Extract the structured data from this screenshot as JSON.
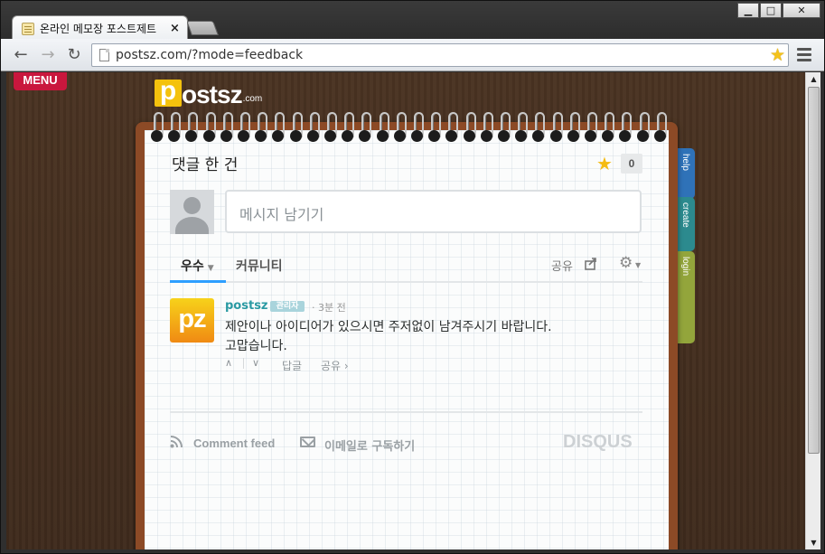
{
  "browser": {
    "tab_title": "온라인 메모장 포스트제트",
    "tab_close": "×",
    "url": "postsz.com/?mode=feedback",
    "window_controls": {
      "minimize": "▁",
      "maximize": "□",
      "close": "✕"
    },
    "icons": {
      "back": "arrow-left",
      "forward": "arrow-right",
      "reload": "reload",
      "bookmark": "star",
      "menu": "hamburger"
    }
  },
  "site": {
    "menu_label": "MENU",
    "logo": {
      "letter": "p",
      "rest": "ostsz",
      "suffix": ".com"
    },
    "side_tabs": [
      {
        "label": "help",
        "color": "#2f72b8"
      },
      {
        "label": "create",
        "color": "#2c8a8e"
      },
      {
        "label": "login",
        "color": "#93a53b"
      }
    ]
  },
  "disqus": {
    "title": "댓글 한 건",
    "star_count": "0",
    "input_placeholder": "메시지 남기기",
    "tabs": {
      "sort_label": "우수",
      "community_label": "커뮤니티"
    },
    "share_label": "공유",
    "post": {
      "avatar_text": "pz",
      "author": "postsz",
      "badge": "관리자",
      "time": "· 3분 전",
      "body_line1": "제안이나 아이디어가 있으시면 주저없이 남겨주시기 바랍니다.",
      "body_line2": "고맙습니다.",
      "reply_label": "답글",
      "share_label": "공유 ›"
    },
    "footer": {
      "comment_feed_label": "Comment feed",
      "subscribe_label": "이메일로 구독하기",
      "brand": "DISQUS"
    }
  }
}
